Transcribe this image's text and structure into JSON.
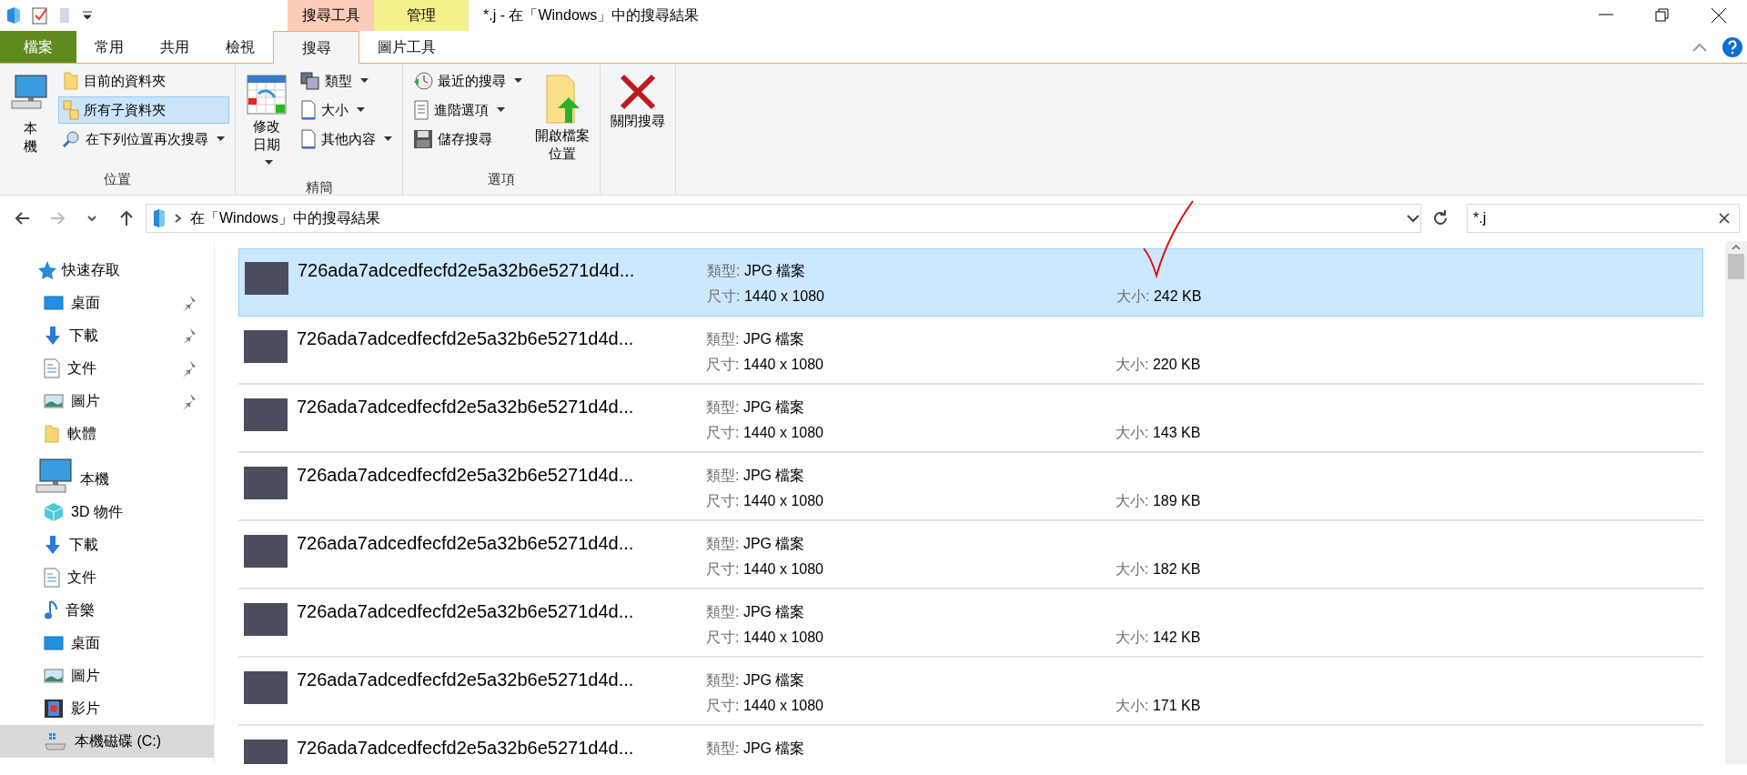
{
  "window": {
    "title": "*.j - 在「Windows」中的搜尋結果"
  },
  "context_groups": [
    {
      "label": "搜尋工具",
      "color": "#fbcdb9"
    },
    {
      "label": "管理",
      "color": "#f2f18c"
    }
  ],
  "ribbon_tabs": [
    {
      "label": "檔案",
      "kind": "file",
      "selected": false
    },
    {
      "label": "常用",
      "kind": "tab",
      "selected": false
    },
    {
      "label": "共用",
      "kind": "tab",
      "selected": false
    },
    {
      "label": "檢視",
      "kind": "tab",
      "selected": false
    },
    {
      "label": "搜尋",
      "kind": "context",
      "selected": true
    },
    {
      "label": "圖片工具",
      "kind": "context",
      "selected": false
    }
  ],
  "ribbon_groups": [
    {
      "label": "位置",
      "columns": [
        [
          {
            "label": "本機",
            "kind": "pc",
            "dropdown": false,
            "selected": false
          }
        ],
        [
          {
            "label": "目前的資料夾",
            "kind": "folder",
            "dropdown": false,
            "selected": false
          },
          {
            "label": "所有子資料夾",
            "kind": "subfolders",
            "dropdown": false,
            "selected": true
          },
          {
            "label": "在下列位置再次搜尋",
            "kind": "search-again",
            "dropdown": true,
            "selected": false
          }
        ]
      ]
    },
    {
      "label": "精簡",
      "columns": [
        [
          {
            "label": "修改日期",
            "kind": "calendar",
            "dropdown": true,
            "selected": false
          }
        ],
        [
          {
            "label": "類型",
            "kind": "type",
            "dropdown": true,
            "selected": false
          },
          {
            "label": "大小",
            "kind": "page",
            "dropdown": true,
            "selected": false
          },
          {
            "label": "其他內容",
            "kind": "page",
            "dropdown": true,
            "selected": false
          }
        ]
      ]
    },
    {
      "label": "選項",
      "columns": [
        [
          {
            "label": "最近的搜尋",
            "kind": "clock",
            "dropdown": true,
            "selected": false
          },
          {
            "label": "進階選項",
            "kind": "list",
            "dropdown": true,
            "selected": false
          },
          {
            "label": "儲存搜尋",
            "kind": "disk",
            "dropdown": false,
            "selected": false
          }
        ],
        [
          {
            "label": "開啟檔案位置",
            "kind": "open-location",
            "dropdown": false,
            "selected": false
          }
        ]
      ]
    },
    {
      "columns": [
        [
          {
            "label": "關閉搜尋",
            "kind": "close-x",
            "dropdown": false,
            "selected": false
          }
        ]
      ]
    }
  ],
  "address_bar": {
    "path": "在「Windows」中的搜尋結果"
  },
  "search_box": {
    "value": "*.j"
  },
  "navigation": [
    {
      "label": "快速存取",
      "kind": "star",
      "children": [
        {
          "label": "桌面",
          "kind": "desktop",
          "pinned": true,
          "selected": false
        },
        {
          "label": "下載",
          "kind": "download",
          "pinned": true,
          "selected": false
        },
        {
          "label": "文件",
          "kind": "document",
          "pinned": true,
          "selected": false
        },
        {
          "label": "圖片",
          "kind": "picture",
          "pinned": true,
          "selected": false
        },
        {
          "label": "軟體",
          "kind": "folder",
          "pinned": false,
          "selected": false
        }
      ]
    },
    {
      "label": "本機",
      "kind": "pc",
      "children": [
        {
          "label": "3D 物件",
          "kind": "cube",
          "pinned": false,
          "selected": false
        },
        {
          "label": "下載",
          "kind": "download",
          "pinned": false,
          "selected": false
        },
        {
          "label": "文件",
          "kind": "document",
          "pinned": false,
          "selected": false
        },
        {
          "label": "音樂",
          "kind": "music",
          "pinned": false,
          "selected": false
        },
        {
          "label": "桌面",
          "kind": "desktop",
          "pinned": false,
          "selected": false
        },
        {
          "label": "圖片",
          "kind": "picture",
          "pinned": false,
          "selected": false
        },
        {
          "label": "影片",
          "kind": "video",
          "pinned": false,
          "selected": false
        },
        {
          "label": "本機磁碟 (C:)",
          "kind": "drive",
          "pinned": false,
          "selected": true
        }
      ]
    }
  ],
  "files": [
    {
      "name": "726ada7adcedfecfd2e5a32b6e5271d4d...",
      "type_label": "類型:",
      "type": "JPG 檔案",
      "dims_label": "尺寸:",
      "dims": "1440 x 1080",
      "size_label": "大小:",
      "size": "242 KB",
      "selected": true
    },
    {
      "name": "726ada7adcedfecfd2e5a32b6e5271d4d...",
      "type_label": "類型:",
      "type": "JPG 檔案",
      "dims_label": "尺寸:",
      "dims": "1440 x 1080",
      "size_label": "大小:",
      "size": "220 KB",
      "selected": false
    },
    {
      "name": "726ada7adcedfecfd2e5a32b6e5271d4d...",
      "type_label": "類型:",
      "type": "JPG 檔案",
      "dims_label": "尺寸:",
      "dims": "1440 x 1080",
      "size_label": "大小:",
      "size": "143 KB",
      "selected": false
    },
    {
      "name": "726ada7adcedfecfd2e5a32b6e5271d4d...",
      "type_label": "類型:",
      "type": "JPG 檔案",
      "dims_label": "尺寸:",
      "dims": "1440 x 1080",
      "size_label": "大小:",
      "size": "189 KB",
      "selected": false
    },
    {
      "name": "726ada7adcedfecfd2e5a32b6e5271d4d...",
      "type_label": "類型:",
      "type": "JPG 檔案",
      "dims_label": "尺寸:",
      "dims": "1440 x 1080",
      "size_label": "大小:",
      "size": "182 KB",
      "selected": false
    },
    {
      "name": "726ada7adcedfecfd2e5a32b6e5271d4d...",
      "type_label": "類型:",
      "type": "JPG 檔案",
      "dims_label": "尺寸:",
      "dims": "1440 x 1080",
      "size_label": "大小:",
      "size": "142 KB",
      "selected": false
    },
    {
      "name": "726ada7adcedfecfd2e5a32b6e5271d4d...",
      "type_label": "類型:",
      "type": "JPG 檔案",
      "dims_label": "尺寸:",
      "dims": "1440 x 1080",
      "size_label": "大小:",
      "size": "171 KB",
      "selected": false
    },
    {
      "name": "726ada7adcedfecfd2e5a32b6e5271d4d...",
      "type_label": "類型:",
      "type": "JPG 檔案",
      "selected": false
    }
  ]
}
